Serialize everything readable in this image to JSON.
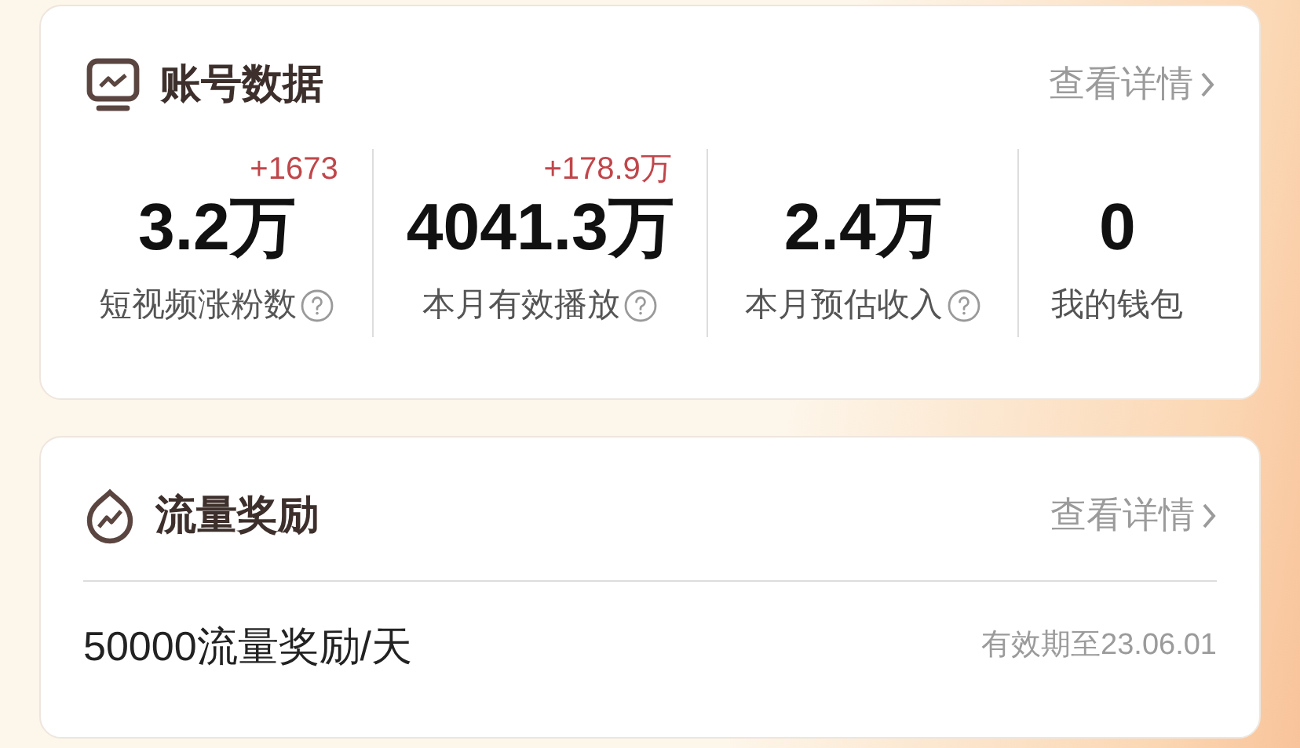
{
  "account_card": {
    "title": "账号数据",
    "details_link": "查看详情",
    "stats": [
      {
        "delta": "+1673",
        "value": "3.2万",
        "label": "短视频涨粉数",
        "help": true
      },
      {
        "delta": "+178.9万",
        "value": "4041.3万",
        "label": "本月有效播放",
        "help": true
      },
      {
        "value": "2.4万",
        "label": "本月预估收入",
        "help": true
      },
      {
        "value": "0",
        "label": "我的钱包",
        "help": false
      }
    ]
  },
  "reward_card": {
    "title": "流量奖励",
    "details_link": "查看详情",
    "item": {
      "text": "50000流量奖励/天",
      "expiry": "有效期至23.06.01"
    }
  }
}
